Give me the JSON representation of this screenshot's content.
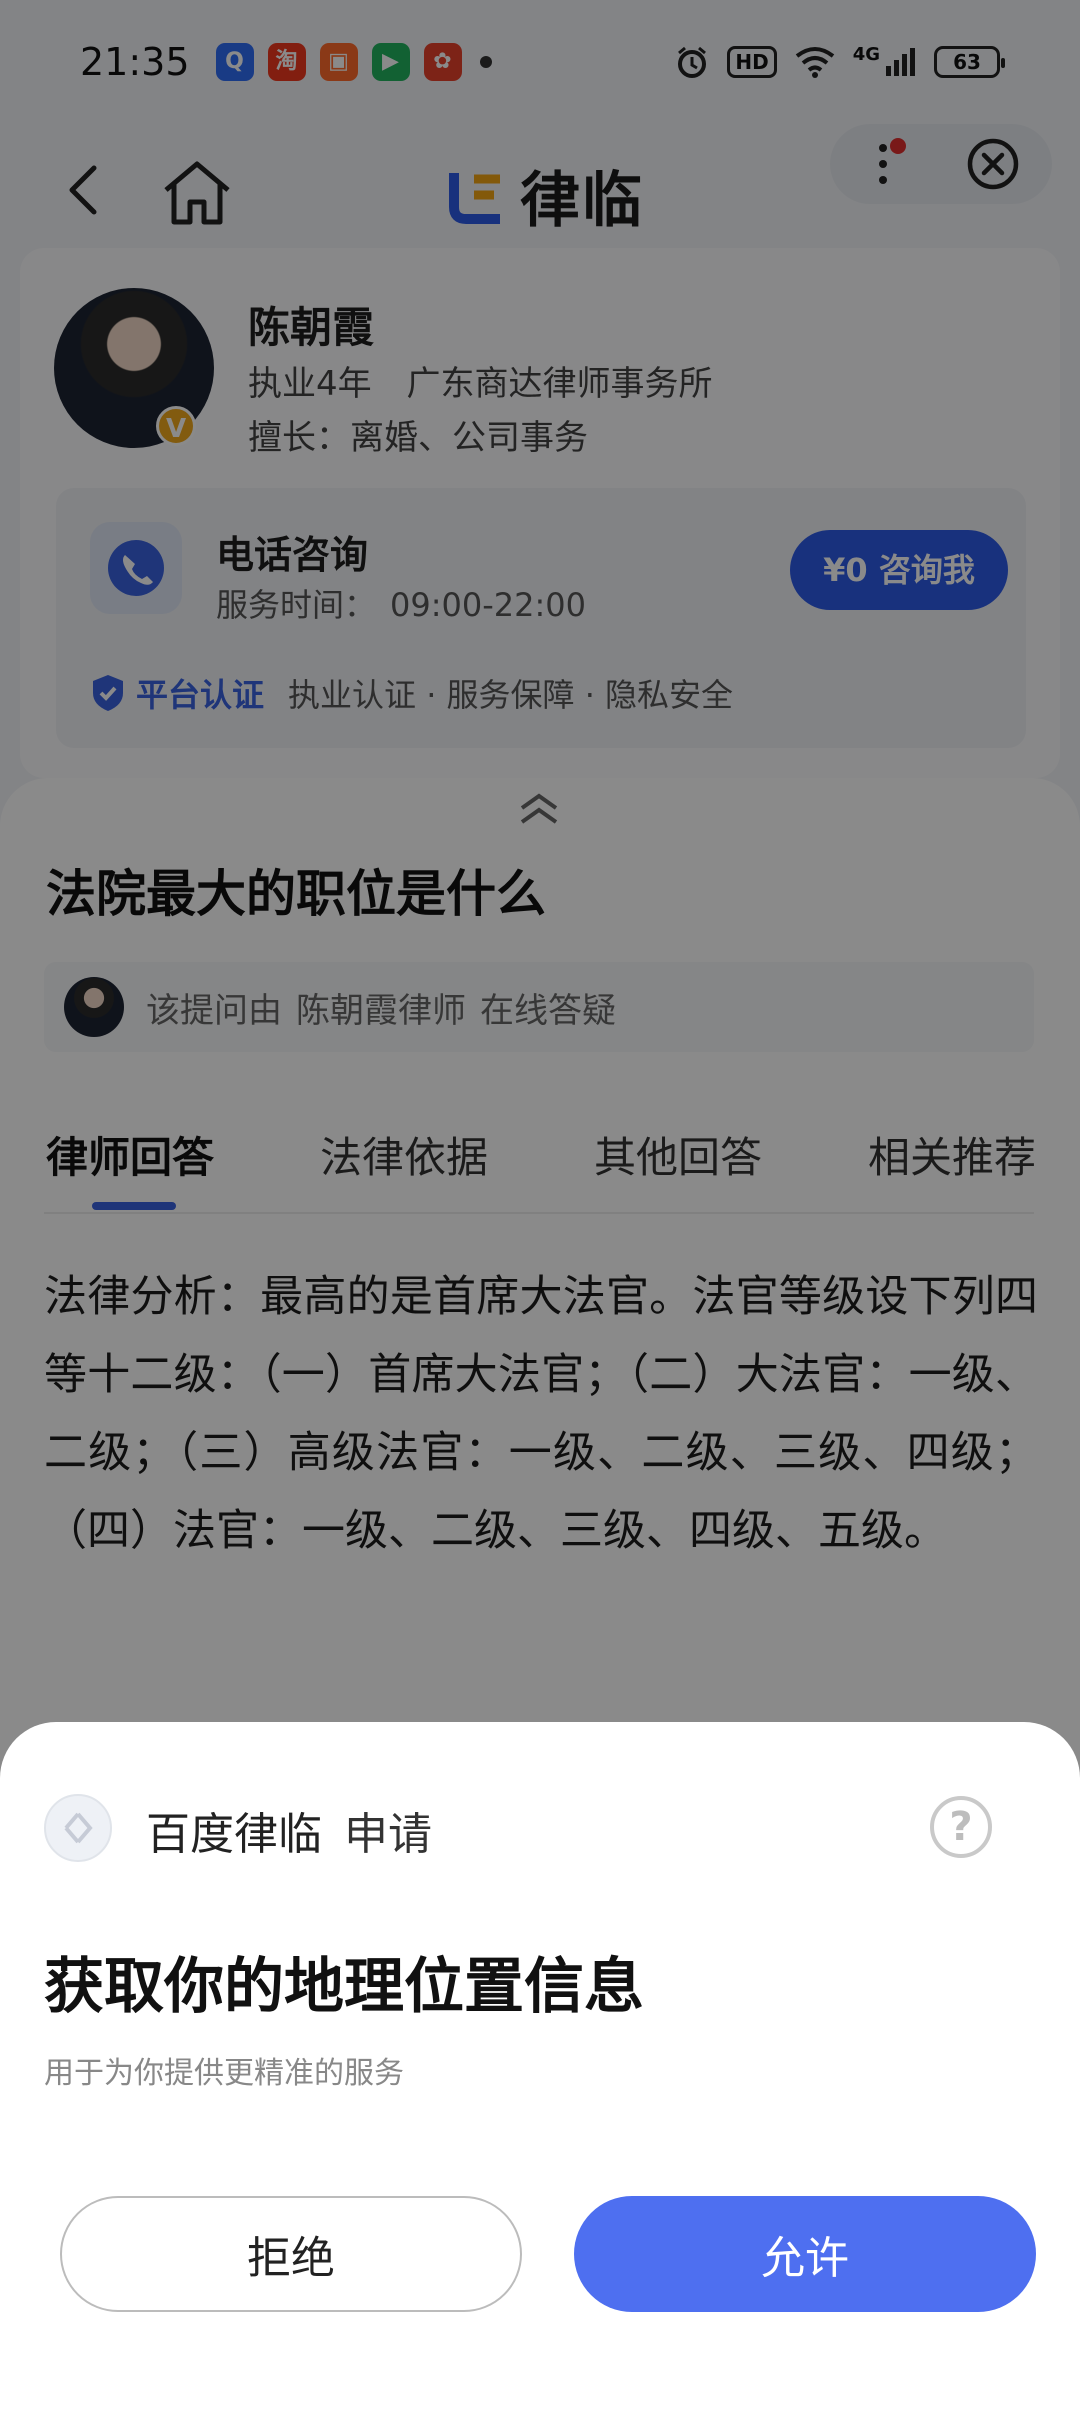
{
  "status_bar": {
    "time": "21:35",
    "notification_icons": [
      "qq-icon",
      "taobao-icon",
      "app-icon",
      "video-icon",
      "shop-icon"
    ],
    "network": "4G",
    "hd": "HD",
    "battery": "63"
  },
  "nav": {
    "brand": "律临"
  },
  "lawyer": {
    "name": "陈朝霞",
    "years": "执业4年",
    "firm": "广东商达律师事务所",
    "specialty": "擅长：离婚、公司事务",
    "badge": "V"
  },
  "consult": {
    "title": "电话咨询",
    "time_label": "服务时间：",
    "time_value": "09:00-22:00",
    "button": "¥0 咨询我",
    "cert_label": "平台认证",
    "cert_desc": "执业认证 · 服务保障 · 隐私安全"
  },
  "question": {
    "title": "法院最大的职位是什么",
    "asked_prefix": "该提问由",
    "asked_by": "陈朝霞律师",
    "asked_suffix": "在线答疑"
  },
  "tabs": [
    {
      "label": "律师回答",
      "active": true
    },
    {
      "label": "法律依据",
      "active": false
    },
    {
      "label": "其他回答",
      "active": false
    },
    {
      "label": "相关推荐",
      "active": false
    }
  ],
  "answer": "法律分析：最高的是首席大法官。法官等级设下列四等十二级：（一）首席大法官；（二）大法官：一级、二级；（三）高级法官：一级、二级、三级、四级；（四）法官：一级、二级、三级、四级、五级。",
  "permission": {
    "app_name": "百度律临",
    "request": "申请",
    "title": "获取你的地理位置信息",
    "desc": "用于为你提供更精准的服务",
    "deny": "拒绝",
    "allow": "允许",
    "help": "?"
  },
  "colors": {
    "accent": "#2e5be8",
    "allow_button": "#4e6ff0",
    "overlay": "rgba(0,0,0,0.46)"
  }
}
